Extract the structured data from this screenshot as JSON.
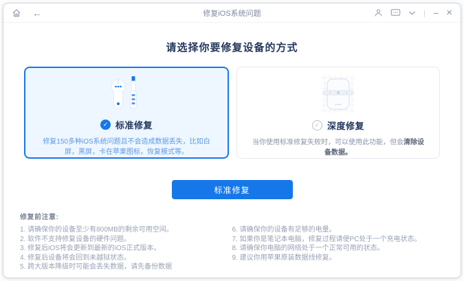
{
  "titlebar": {
    "title": "修复iOS系统问题",
    "back_glyph": "←",
    "divider_glyph": "|",
    "minus_glyph": "−",
    "close_glyph": "×"
  },
  "heading": "请选择你要修复设备的方式",
  "cards": {
    "standard": {
      "title": "标准修复",
      "description": "修复150多种iOS系统问题且不会造成数据丢失，比如白屏，黑屏，卡在苹果图标，恢复模式等。",
      "check_glyph": "✓",
      "selected": true
    },
    "deep": {
      "title": "深度修复",
      "description_prefix": "当你使用标准修复失败时，可以使用此功能，但会",
      "description_emphasis": "清除设备数据。",
      "check_glyph": "✓",
      "selected": false
    }
  },
  "action_button": {
    "label": "标准修复"
  },
  "notes": {
    "heading": "修复前注意:",
    "left_items": [
      "1. 请确保你的设备至少有800MB的剩余可用空间。",
      "2. 软件不支持修复设备的硬件问题。",
      "3. 修复后iOS将会更新到最新的iOS正式版本。",
      "4. 修复后设备将会回到未越狱状态。",
      "5. 跨大版本降级时可能会丢失数据，请先备份数据"
    ],
    "right_items": [
      "6. 请确保你的设备有足够的电量。",
      "7. 如果你是笔记本电脑，修复过程请使PC处于一个充电状态。",
      "8. 请确保你电脑的网络处于一个正常可用的状态。",
      "9. 建议你用苹果原装数据线修复。"
    ]
  },
  "colors": {
    "accent_blue": "#1677e8",
    "selected_card_bg": "#eef6ff",
    "selected_card_border": "#1677e8",
    "card_border": "#e6e9f0",
    "heading_text": "#24385e",
    "blue_desc_text": "#5e9be4",
    "muted_text": "#98a2b4",
    "titlebar_icon": "#8a95a8"
  }
}
